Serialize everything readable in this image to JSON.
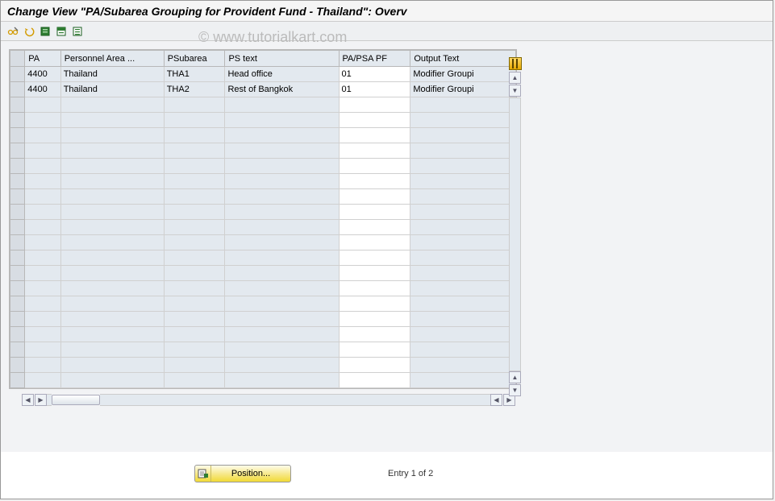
{
  "title": "Change View \"PA/Subarea Grouping for Provident Fund - Thailand\": Overv",
  "watermark": "© www.tutorialkart.com",
  "columns": {
    "pa": "PA",
    "patext": "Personnel Area ...",
    "psubarea": "PSubarea",
    "pstext": "PS text",
    "papsa": "PA/PSA PF",
    "output": "Output Text"
  },
  "rows": [
    {
      "pa": "4400",
      "patext": "Thailand",
      "psubarea": "THA1",
      "pstext": "Head office",
      "papsa": "01",
      "output": "Modifier Groupi"
    },
    {
      "pa": "4400",
      "patext": "Thailand",
      "psubarea": "THA2",
      "pstext": "Rest of Bangkok",
      "papsa": "01",
      "output": "Modifier Groupi"
    }
  ],
  "footer": {
    "position_label": "Position...",
    "entry_text": "Entry 1 of 2"
  }
}
